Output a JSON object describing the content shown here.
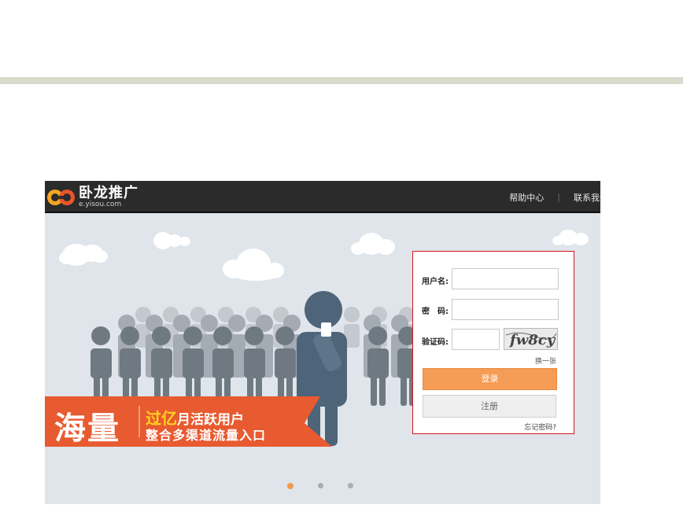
{
  "header": {
    "logo_title": "卧龙推广",
    "logo_subtitle": "e.yisou.com",
    "nav": [
      "帮助中心",
      "联系我们"
    ]
  },
  "banner": {
    "big_word": "海量",
    "line1_highlight": "过亿",
    "line1_rest": "月活跃用户",
    "line2": "整合多渠道流量入口",
    "slide_count": 3,
    "active_slide": 1
  },
  "login": {
    "username_label": "用户名:",
    "password_label": "密　码:",
    "captcha_label": "验证码:",
    "captcha_text": "fw8cy",
    "refresh_label": "换一张",
    "login_button": "登录",
    "register_button": "注册",
    "forgot_link": "忘记密码?"
  },
  "colors": {
    "header_bg": "#2b2b2b",
    "banner_bg": "#dfe5ea",
    "ribbon": "#e85a30",
    "highlight_yellow": "#ffd21e",
    "login_button": "#f59c56",
    "login_border": "#d9141e",
    "active_dot": "#f39a4a"
  }
}
